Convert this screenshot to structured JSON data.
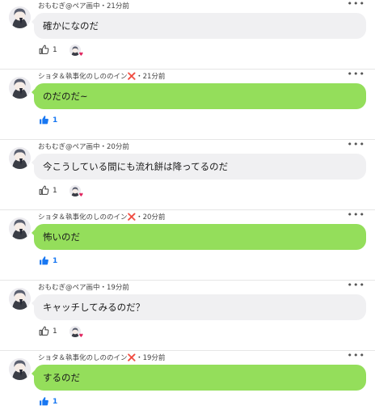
{
  "colors": {
    "gray_bubble": "#f0f0f2",
    "green_bubble": "#94de5b",
    "like_active": "#1877f2",
    "cross_mark": "#d8262c"
  },
  "icons": {
    "more": "more-icon",
    "like": "thumbs-up-icon",
    "cross": "red-cross-icon",
    "heart": "heart-icon"
  },
  "comments": [
    {
      "author": "おもむぎ@ペア画中",
      "author_mark": "",
      "time": "・21分前",
      "text": "確かになのだ",
      "bubble": "gray",
      "likes": "1",
      "liked_by_me": false,
      "more": "•••",
      "liker_heart": "♥"
    },
    {
      "author": "ショタ＆執事化のしののイン",
      "author_mark": "❌",
      "time": "・21分前",
      "text": "のだのだ~",
      "bubble": "green",
      "likes": "1",
      "liked_by_me": true,
      "more": "•••",
      "liker_heart": ""
    },
    {
      "author": "おもむぎ@ペア画中",
      "author_mark": "",
      "time": "・20分前",
      "text": "今こうしている間にも流れ餅は降ってるのだ",
      "bubble": "gray",
      "likes": "1",
      "liked_by_me": false,
      "more": "•••",
      "liker_heart": "♥"
    },
    {
      "author": "ショタ＆執事化のしののイン",
      "author_mark": "❌",
      "time": "・20分前",
      "text": "怖いのだ",
      "bubble": "green",
      "likes": "1",
      "liked_by_me": true,
      "more": "•••",
      "liker_heart": ""
    },
    {
      "author": "おもむぎ@ペア画中",
      "author_mark": "",
      "time": "・19分前",
      "text": "キャッチしてみるのだ？",
      "bubble": "gray",
      "likes": "1",
      "liked_by_me": false,
      "more": "•••",
      "liker_heart": "♥"
    },
    {
      "author": "ショタ＆執事化のしののイン",
      "author_mark": "❌",
      "time": "・19分前",
      "text": "するのだ",
      "bubble": "green",
      "likes": "1",
      "liked_by_me": true,
      "more": "•••",
      "liker_heart": ""
    }
  ]
}
